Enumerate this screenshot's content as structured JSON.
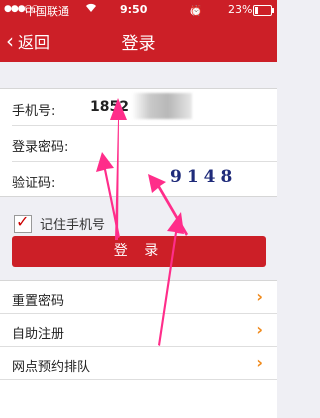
{
  "status_bar": {
    "carrier": "中国联通",
    "time": "9:50",
    "battery": "23%",
    "battery_level": 0.23
  },
  "nav": {
    "back_label": "返回",
    "title": "登录"
  },
  "form": {
    "phone_label": "手机号:",
    "phone_value": "1852",
    "password_label": "登录密码:",
    "captcha_label": "验证码:",
    "captcha_text": "9148"
  },
  "remember": {
    "label": "记住手机号",
    "checked": true
  },
  "login_button": "登  录",
  "menu": [
    {
      "label": "重置密码"
    },
    {
      "label": "自助注册"
    },
    {
      "label": "网点预约排队"
    }
  ],
  "colors": {
    "brand_red": "#cc1f27",
    "arrow_orange": "#f08a1c",
    "annotation_pink": "#ff2d8a"
  },
  "icons": [
    "signal-dots-icon",
    "wifi-icon",
    "lock-rotation-icon",
    "location-icon",
    "alarm-icon",
    "battery-icon",
    "back-chevron-icon",
    "check-icon",
    "chevron-right-icon"
  ]
}
